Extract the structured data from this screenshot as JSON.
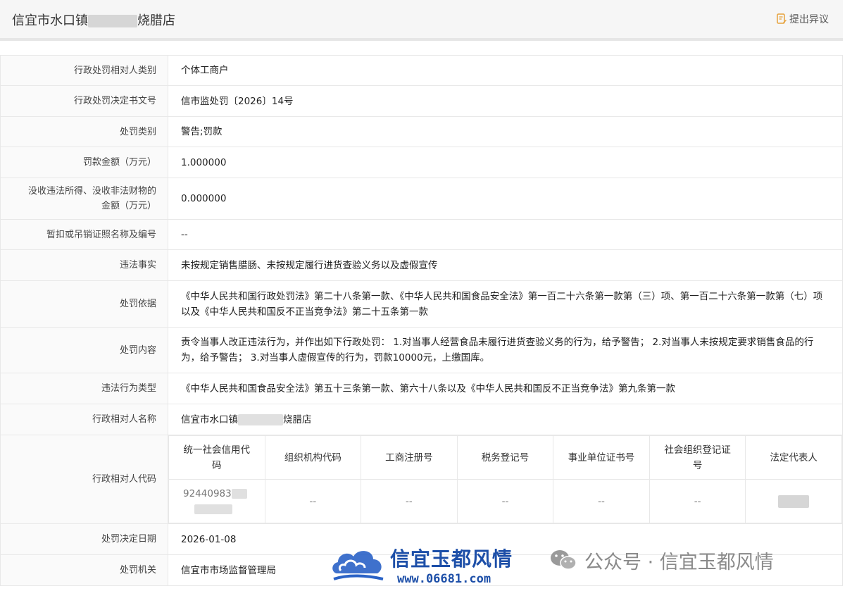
{
  "header": {
    "title_prefix": "信宜市水口镇",
    "title_suffix": "烧腊店",
    "objection_label": "提出异议",
    "objection_icon": "document-edit-icon",
    "accent_color": "#e6a23c"
  },
  "rows": {
    "party_type": {
      "label": "行政处罚相对人类别",
      "value": "个体工商户"
    },
    "decision_no": {
      "label": "行政处罚决定书文号",
      "value": "信市监处罚〔2026〕14号"
    },
    "penalty_type": {
      "label": "处罚类别",
      "value": "警告;罚款"
    },
    "fine_amount": {
      "label": "罚款金额（万元）",
      "value": "1.000000"
    },
    "confiscation": {
      "label_line1": "没收违法所得、没收非法财物的",
      "label_line2": "金额（万元）",
      "value": "0.000000"
    },
    "license_revoked": {
      "label": "暂扣或吊销证照名称及编号",
      "value": "--"
    },
    "violation_facts": {
      "label": "违法事实",
      "value": "未按规定销售腊肠、未按规定履行进货查验义务以及虚假宣传"
    },
    "penalty_basis": {
      "label": "处罚依据",
      "value": "《中华人民共和国行政处罚法》第二十八条第一款、《中华人民共和国食品安全法》第一百二十六条第一款第（三）项、第一百二十六条第一款第（七）项以及《中华人民共和国反不正当竞争法》第二十五条第一款"
    },
    "penalty_content": {
      "label": "处罚内容",
      "value": "责令当事人改正违法行为，并作出如下行政处罚： 1.对当事人经营食品未履行进货查验义务的行为，给予警告； 2.对当事人未按规定要求销售食品的行为，给予警告； 3.对当事人虚假宣传的行为，罚款10000元，上缴国库。"
    },
    "violation_type": {
      "label": "违法行为类型",
      "value": "《中华人民共和国食品安全法》第五十三条第一款、第六十八条以及《中华人民共和国反不正当竞争法》第九条第一款"
    },
    "party_name": {
      "label": "行政相对人名称",
      "value_prefix": "信宜市水口镇",
      "value_suffix": "烧腊店"
    },
    "party_code": {
      "label": "行政相对人代码",
      "columns": [
        "统一社会信用代码",
        "组织机构代码",
        "工商注册号",
        "税务登记号",
        "事业单位证书号",
        "社会组织登记证号",
        "法定代表人"
      ],
      "credit_code_visible": "92440983",
      "values": [
        "--",
        "--",
        "--",
        "--",
        "--"
      ]
    },
    "decision_date": {
      "label": "处罚决定日期",
      "value": "2026-01-08"
    },
    "authority": {
      "label": "处罚机关",
      "value": "信宜市市场监督管理局"
    }
  },
  "watermark": {
    "brand": "信宜玉都风情",
    "url": "www.06681.com",
    "account": "公众号 · 信宜玉都风情",
    "brand_color": "#1d4fa8"
  }
}
